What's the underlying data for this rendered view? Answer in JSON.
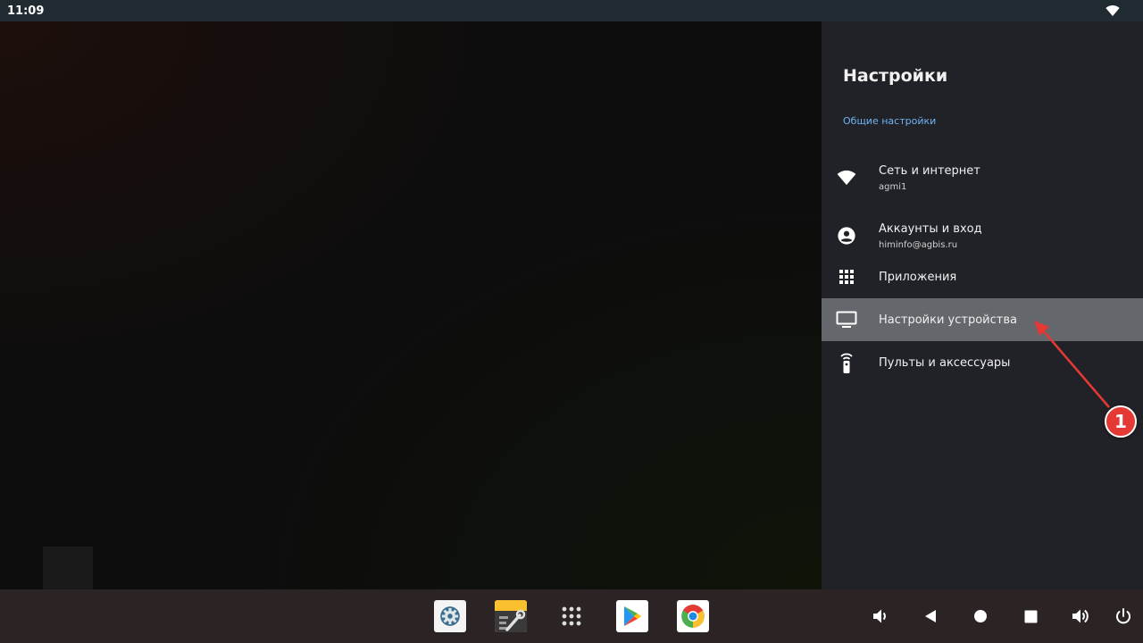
{
  "status_bar": {
    "time": "11:09",
    "wifi_icon": "wifi-icon"
  },
  "settings": {
    "title": "Настройки",
    "section_label": "Общие настройки",
    "items": [
      {
        "label": "Сеть и интернет",
        "sublabel": "agmi1",
        "icon": "wifi-icon"
      },
      {
        "label": "Аккаунты и вход",
        "sublabel": "himinfo@agbis.ru",
        "icon": "account-circle-icon"
      },
      {
        "label": "Приложения",
        "icon": "apps-grid-icon"
      },
      {
        "label": "Настройки устройства",
        "icon": "tv-icon",
        "selected": true
      },
      {
        "label": "Пульты и аксессуары",
        "icon": "remote-icon"
      }
    ]
  },
  "taskbar": {
    "apps": [
      "settings-app-icon",
      "toolbox-app-icon",
      "all-apps-icon",
      "play-store-icon",
      "chrome-icon"
    ],
    "nav": [
      "volume-down-icon",
      "back-icon",
      "home-icon",
      "recents-icon",
      "volume-up-icon",
      "power-icon"
    ]
  },
  "annotation": {
    "number": "1"
  },
  "colors": {
    "accent": "#6fb3f2",
    "panel": "#212227",
    "selected": "#64676b",
    "annotation": "#e53935"
  }
}
